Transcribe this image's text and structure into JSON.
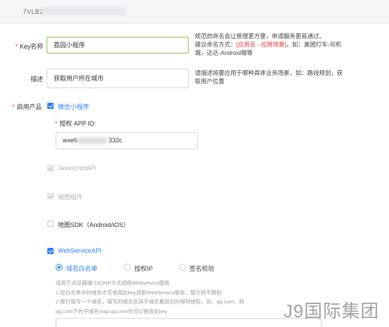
{
  "header": {
    "key_prefix": "7VLB2"
  },
  "form": {
    "key_name": {
      "required_mark": "*",
      "label": "Key名称",
      "value": "荔园小程序",
      "hint_line1": "规范的命名会让管理更方便，申请服务更易通过。",
      "hint_line2_prefix": "建议命名方式：",
      "hint_line2_highlight": "[应用名 - 应用场景]",
      "hint_line2_suffix": "，如：美团打车-司机",
      "hint_line3": "端，达达-Android端等"
    },
    "description": {
      "label": "描述",
      "value": "获取用户所在城市",
      "hint_line1": "请描述将要应用于哪种具体业务场景，如：路线规划，获",
      "hint_line2": "取用户位置"
    },
    "products": {
      "required_mark": "*",
      "label": "启用产品",
      "mini_program": {
        "label": "微信小程序",
        "checked": true,
        "appid": {
          "required_mark": "*",
          "label": "授权 APP ID:",
          "value_prefix": "wxe6",
          "value_suffix": "332c"
        }
      },
      "javascript_api": {
        "label": "JavascriptAPI",
        "checked": true,
        "disabled": true
      },
      "map_component": {
        "label": "地图组件",
        "checked": true,
        "disabled": true
      },
      "map_sdk": {
        "label": "地图SDK（Android/iOS）",
        "checked": false
      },
      "webservice_api": {
        "label": "WebServiceAPI",
        "checked": true,
        "radios": [
          {
            "label": "域名白名单",
            "selected": true
          },
          {
            "label": "授权IP",
            "selected": false
          },
          {
            "label": "签名校验",
            "selected": false
          }
        ],
        "desc_line1": "适用于浏览器端/JSONP方式调用Webservice服务",
        "desc_line2": "1.仅白名单中的域名才可使用此key调用WebService服务，留空则不限制",
        "desc_line3": "2.每行填写一个域名，填写的域名及其子域名都会同时得到授权，如：qq.com，则",
        "desc_line4": "qq.com下的子域名map.qq.com也可以使用此key"
      }
    }
  },
  "watermark": "J9国际集团",
  "colors": {
    "accent_blue": "#2d7ff9",
    "required_red": "#e4393c",
    "active_border_green": "#8bc34a",
    "topbar_bg": "#f5f6f8"
  }
}
